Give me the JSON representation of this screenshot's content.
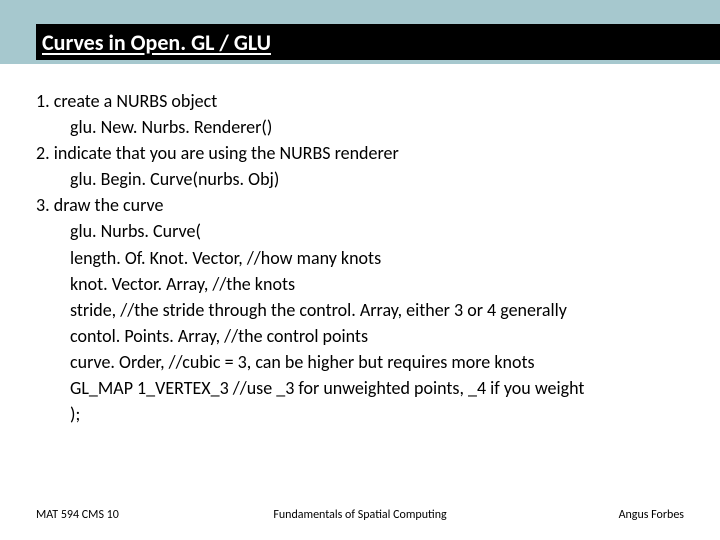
{
  "title": "Curves in Open. GL / GLU",
  "lines": [
    {
      "text": "1. create a NURBS object",
      "indent": false
    },
    {
      "text": "glu. New. Nurbs. Renderer()",
      "indent": true
    },
    {
      "text": "2. indicate that you are using the NURBS renderer",
      "indent": false
    },
    {
      "text": "glu. Begin. Curve(nurbs. Obj)",
      "indent": true
    },
    {
      "text": "3. draw the curve",
      "indent": false
    },
    {
      "text": "glu. Nurbs. Curve(",
      "indent": true
    },
    {
      "text": "length. Of. Knot. Vector, //how many knots",
      "indent": true
    },
    {
      "text": "knot. Vector. Array, //the knots",
      "indent": true
    },
    {
      "text": "stride, //the stride through the control. Array, either 3 or 4 generally",
      "indent": true
    },
    {
      "text": "contol. Points. Array, //the control points",
      "indent": true
    },
    {
      "text": "curve. Order, //cubic = 3, can be higher but requires more knots",
      "indent": true
    },
    {
      "text": "GL_MAP 1_VERTEX_3 //use _3 for unweighted points, _4 if you weight",
      "indent": true
    },
    {
      "text": ");",
      "indent": true
    }
  ],
  "footer": {
    "left": "MAT 594 CMS 10",
    "center": "Fundamentals of Spatial Computing",
    "right": "Angus Forbes"
  }
}
